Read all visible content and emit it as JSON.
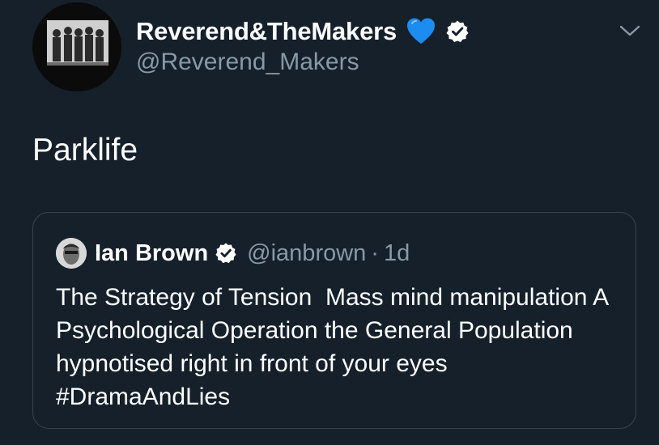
{
  "author": {
    "display_name": "Reverend&TheMakers",
    "handle": "@Reverend_Makers",
    "emoji": "blue-heart-icon",
    "verified": true
  },
  "tweet": {
    "text": "Parklife"
  },
  "quoted_tweet": {
    "display_name": "Ian Brown",
    "handle": "@ianbrown",
    "separator": "·",
    "time": "1d",
    "verified": true,
    "text": "The Strategy of Tension  Mass mind manipulation A Psychological Operation the General Population hypnotised right in front of your eyes #DramaAndLies"
  },
  "colors": {
    "background": "#15202b",
    "secondary_text": "#8899a6",
    "border": "#38444d",
    "heart": "#1d8cf0"
  }
}
